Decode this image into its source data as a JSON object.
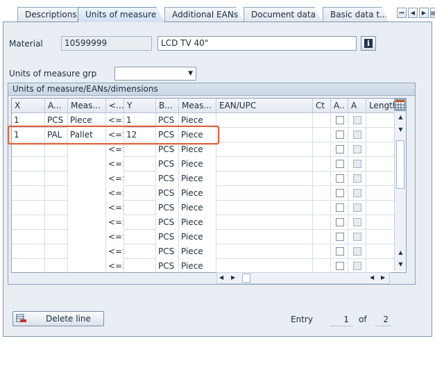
{
  "tabs": [
    {
      "label": "Descriptions",
      "active": false
    },
    {
      "label": "Units of measure",
      "active": true
    },
    {
      "label": "Additional EANs",
      "active": false
    },
    {
      "label": "Document data",
      "active": false
    },
    {
      "label": "Basic data t...",
      "active": false
    }
  ],
  "tab_nav": {
    "first": "⏮",
    "prev": "◀",
    "next": "▶",
    "list": "▤"
  },
  "material": {
    "label": "Material",
    "number": "10599999",
    "description": "LCD TV 40\"",
    "info_icon": "info-icon"
  },
  "uom_group": {
    "label": "Units of measure grp",
    "value": ""
  },
  "group_box": {
    "title": "Units of measure/EANs/dimensions"
  },
  "table": {
    "columns": [
      "X",
      "A...",
      "Meas...",
      "<...",
      "Y",
      "B...",
      "Meas...",
      "EAN/UPC",
      "Ct",
      "A..",
      "A",
      "Length"
    ],
    "rows": [
      {
        "x": "1",
        "a": "PCS",
        "meas": "Piece",
        "op": "<=>",
        "y": "1",
        "b": "PCS",
        "meas2": "Piece",
        "ean": "",
        "ct": ""
      },
      {
        "x": "1",
        "a": "PAL",
        "meas": "Pallet",
        "op": "<=>",
        "y": "12",
        "b": "PCS",
        "meas2": "Piece",
        "ean": "",
        "ct": ""
      },
      {
        "x": "",
        "a": "",
        "meas": "",
        "op": "<=>",
        "y": "",
        "b": "PCS",
        "meas2": "Piece",
        "ean": "",
        "ct": ""
      },
      {
        "x": "",
        "a": "",
        "meas": "",
        "op": "<=>",
        "y": "",
        "b": "PCS",
        "meas2": "Piece",
        "ean": "",
        "ct": ""
      },
      {
        "x": "",
        "a": "",
        "meas": "",
        "op": "<=>",
        "y": "",
        "b": "PCS",
        "meas2": "Piece",
        "ean": "",
        "ct": ""
      },
      {
        "x": "",
        "a": "",
        "meas": "",
        "op": "<=>",
        "y": "",
        "b": "PCS",
        "meas2": "Piece",
        "ean": "",
        "ct": ""
      },
      {
        "x": "",
        "a": "",
        "meas": "",
        "op": "<=>",
        "y": "",
        "b": "PCS",
        "meas2": "Piece",
        "ean": "",
        "ct": ""
      },
      {
        "x": "",
        "a": "",
        "meas": "",
        "op": "<=>",
        "y": "",
        "b": "PCS",
        "meas2": "Piece",
        "ean": "",
        "ct": ""
      },
      {
        "x": "",
        "a": "",
        "meas": "",
        "op": "<=>",
        "y": "",
        "b": "PCS",
        "meas2": "Piece",
        "ean": "",
        "ct": ""
      },
      {
        "x": "",
        "a": "",
        "meas": "",
        "op": "<=>",
        "y": "",
        "b": "PCS",
        "meas2": "Piece",
        "ean": "",
        "ct": ""
      },
      {
        "x": "",
        "a": "",
        "meas": "",
        "op": "<=>",
        "y": "",
        "b": "PCS",
        "meas2": "Piece",
        "ean": "",
        "ct": ""
      }
    ]
  },
  "footer": {
    "delete_label": "Delete line",
    "entry_label": "Entry",
    "entry_current": "1",
    "entry_of": "of",
    "entry_total": "2"
  },
  "colors": {
    "highlight": "#d9623c",
    "active_tab": "#cfe0f1",
    "panel": "#e9eef4"
  }
}
